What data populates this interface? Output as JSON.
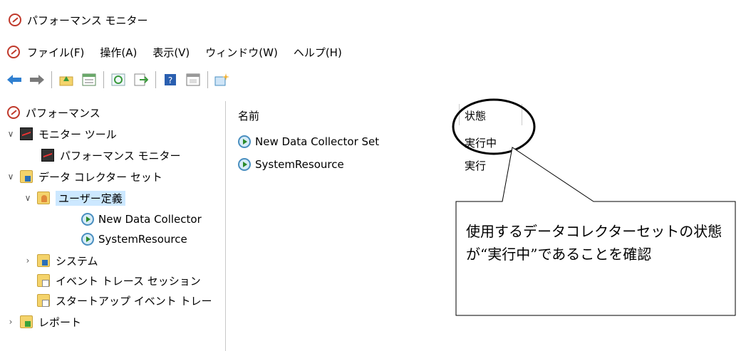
{
  "window": {
    "title": "パフォーマンス モニター"
  },
  "menu": [
    "ファイル(F)",
    "操作(A)",
    "表示(V)",
    "ウィンドウ(W)",
    "ヘルプ(H)"
  ],
  "toolbar": {
    "icons": [
      "back-arrow-icon",
      "forward-arrow-icon",
      "folder-up-icon",
      "properties-icon",
      "refresh-icon",
      "export-icon",
      "help-icon",
      "show-hide-icon",
      "new-icon"
    ]
  },
  "tree": {
    "root": "パフォーマンス",
    "monitor_tools": "モニター ツール",
    "perf_monitor": "パフォーマンス モニター",
    "dcs": "データ コレクター セット",
    "user_defined": "ユーザー定義",
    "item_new_dc": "New Data Collector",
    "item_sysres": "SystemResource",
    "system": "システム",
    "event_trace": "イベント トレース セッション",
    "startup_trace": "スタートアップ イベント トレー",
    "reports": "レポート"
  },
  "list": {
    "col_name": "名前",
    "col_status": "状態",
    "rows": [
      {
        "name": "New Data Collector Set",
        "status": "実行中"
      },
      {
        "name": "SystemResource",
        "status": "実行"
      }
    ]
  },
  "callout": {
    "text": "使用するデータコレクターセットの状態が“実行中”であることを確認"
  },
  "colors": {
    "selection": "#cce8ff",
    "app_icon": "#c0392b"
  }
}
